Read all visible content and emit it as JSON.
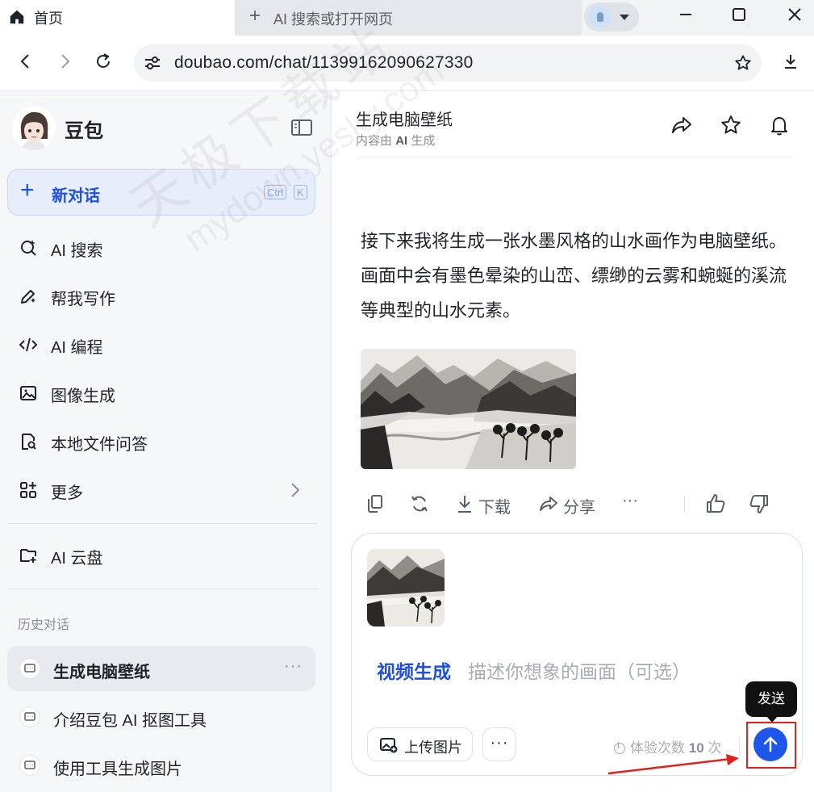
{
  "browser": {
    "active_tab": {
      "label": "首页"
    },
    "new_tab": {
      "label": "AI 搜索或打开网页"
    },
    "url": "doubao.com/chat/11399162090627330"
  },
  "sidebar": {
    "brand": "豆包",
    "new_chat": {
      "label": "新对话",
      "shortcut": [
        "Ctrl",
        "K"
      ]
    },
    "nav_items": [
      {
        "label": "AI 搜索",
        "icon": "ai-search-icon"
      },
      {
        "label": "帮我写作",
        "icon": "pen-icon"
      },
      {
        "label": "AI 编程",
        "icon": "code-icon"
      },
      {
        "label": "图像生成",
        "icon": "image-gen-icon"
      },
      {
        "label": "本地文件问答",
        "icon": "file-search-icon"
      },
      {
        "label": "更多",
        "icon": "apps-icon"
      }
    ],
    "cloud": {
      "label": "AI 云盘",
      "icon": "cloud-folder-icon"
    },
    "history_label": "历史对话",
    "history": [
      {
        "label": "生成电脑壁纸",
        "more": "···",
        "active": true
      },
      {
        "label": "介绍豆包 AI 抠图工具"
      },
      {
        "label": "使用工具生成图片"
      }
    ]
  },
  "chat": {
    "title": "生成电脑壁纸",
    "subtitle_prefix": "内容由",
    "subtitle_ai": "AI",
    "subtitle_suffix": "生成",
    "message": "接下来我将生成一张水墨风格的山水画作为电脑壁纸。画面中会有墨色晕染的山峦、缥缈的云雾和蜿蜒的溪流等典型的山水元素。",
    "actions": {
      "download": "下载",
      "share": "分享",
      "more": "···"
    }
  },
  "composer": {
    "mode": "视频生成",
    "placeholder": "描述你想象的画面（可选）",
    "upload_label": "上传图片",
    "more": "···",
    "quota_prefix": "体验次数",
    "quota_count": "10",
    "quota_suffix": "次",
    "send_tooltip": "发送"
  },
  "watermark": {
    "line1": "天极下载站",
    "line2": "mydown.yesky.com"
  },
  "colors": {
    "accent": "#1d4fe0",
    "send": "#1d57ea",
    "highlight": "#e4201b"
  }
}
